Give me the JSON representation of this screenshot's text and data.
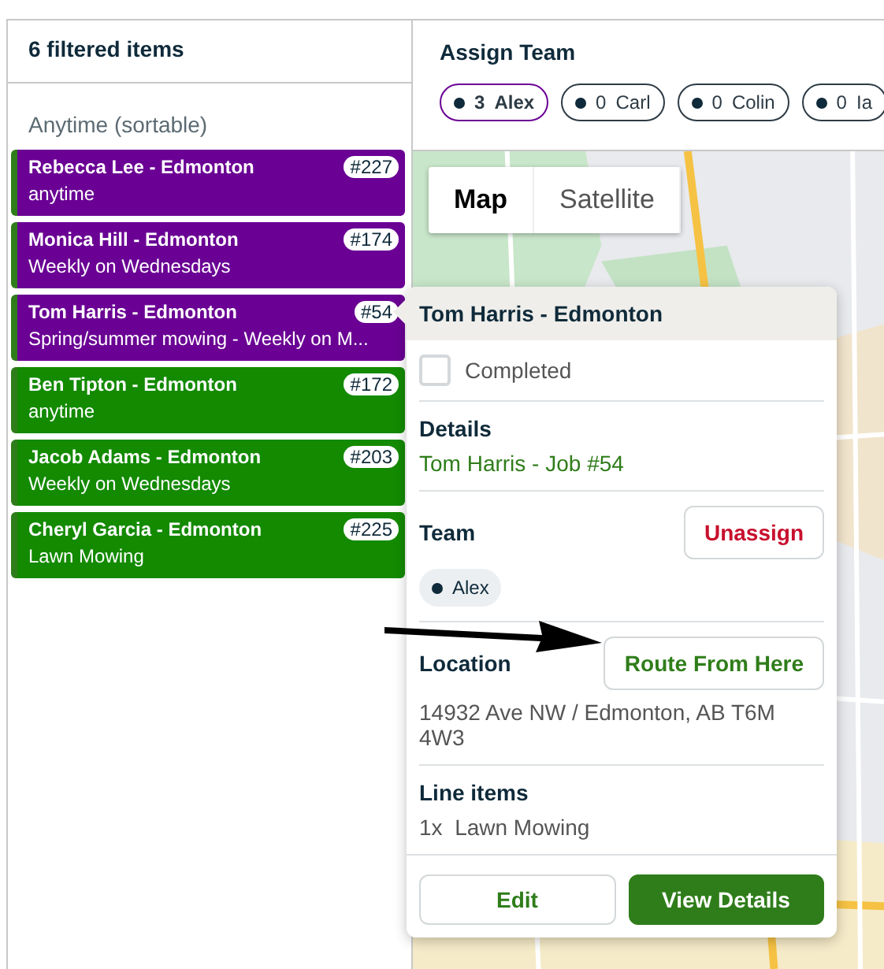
{
  "list_panel": {
    "title": "6 filtered items",
    "group_label": "Anytime (sortable)",
    "items": [
      {
        "name": "Rebecca Lee - Edmonton",
        "number": "#227",
        "schedule": "anytime",
        "color": "#6a0094"
      },
      {
        "name": "Monica Hill - Edmonton",
        "number": "#174",
        "schedule": "Weekly on Wednesdays",
        "color": "#6a0094"
      },
      {
        "name": "Tom Harris - Edmonton",
        "number": "#54",
        "schedule": "Spring/summer mowing - Weekly on M...",
        "color": "#6a0094"
      },
      {
        "name": "Ben Tipton - Edmonton",
        "number": "#172",
        "schedule": "anytime",
        "color": "#138a00"
      },
      {
        "name": "Jacob Adams - Edmonton",
        "number": "#203",
        "schedule": "Weekly on Wednesdays",
        "color": "#138a00"
      },
      {
        "name": "Cheryl Garcia - Edmonton",
        "number": "#225",
        "schedule": "Lawn Mowing",
        "color": "#138a00"
      }
    ]
  },
  "assign_team": {
    "title": "Assign Team",
    "members": [
      {
        "count": "3",
        "name": "Alex",
        "selected": true
      },
      {
        "count": "0",
        "name": "Carl",
        "selected": false
      },
      {
        "count": "0",
        "name": "Colin",
        "selected": false
      },
      {
        "count": "0",
        "name": "Ia",
        "selected": false
      }
    ]
  },
  "map": {
    "view_tabs": [
      {
        "label": "Map",
        "selected": true
      },
      {
        "label": "Satellite",
        "selected": false
      }
    ]
  },
  "popup": {
    "title": "Tom Harris - Edmonton",
    "completed": {
      "label": "Completed",
      "checked": false
    },
    "details": {
      "heading": "Details",
      "link": "Tom Harris - Job #54"
    },
    "team": {
      "heading": "Team",
      "unassign": "Unassign",
      "members": [
        "Alex"
      ]
    },
    "location": {
      "heading": "Location",
      "route": "Route From Here",
      "address": "14932 Ave NW / Edmonton, AB T6M 4W3"
    },
    "line_items": {
      "heading": "Line items",
      "items": [
        {
          "qty": "1x",
          "name": "Lawn Mowing"
        }
      ]
    },
    "buttons": {
      "edit": "Edit",
      "view": "View Details"
    }
  }
}
